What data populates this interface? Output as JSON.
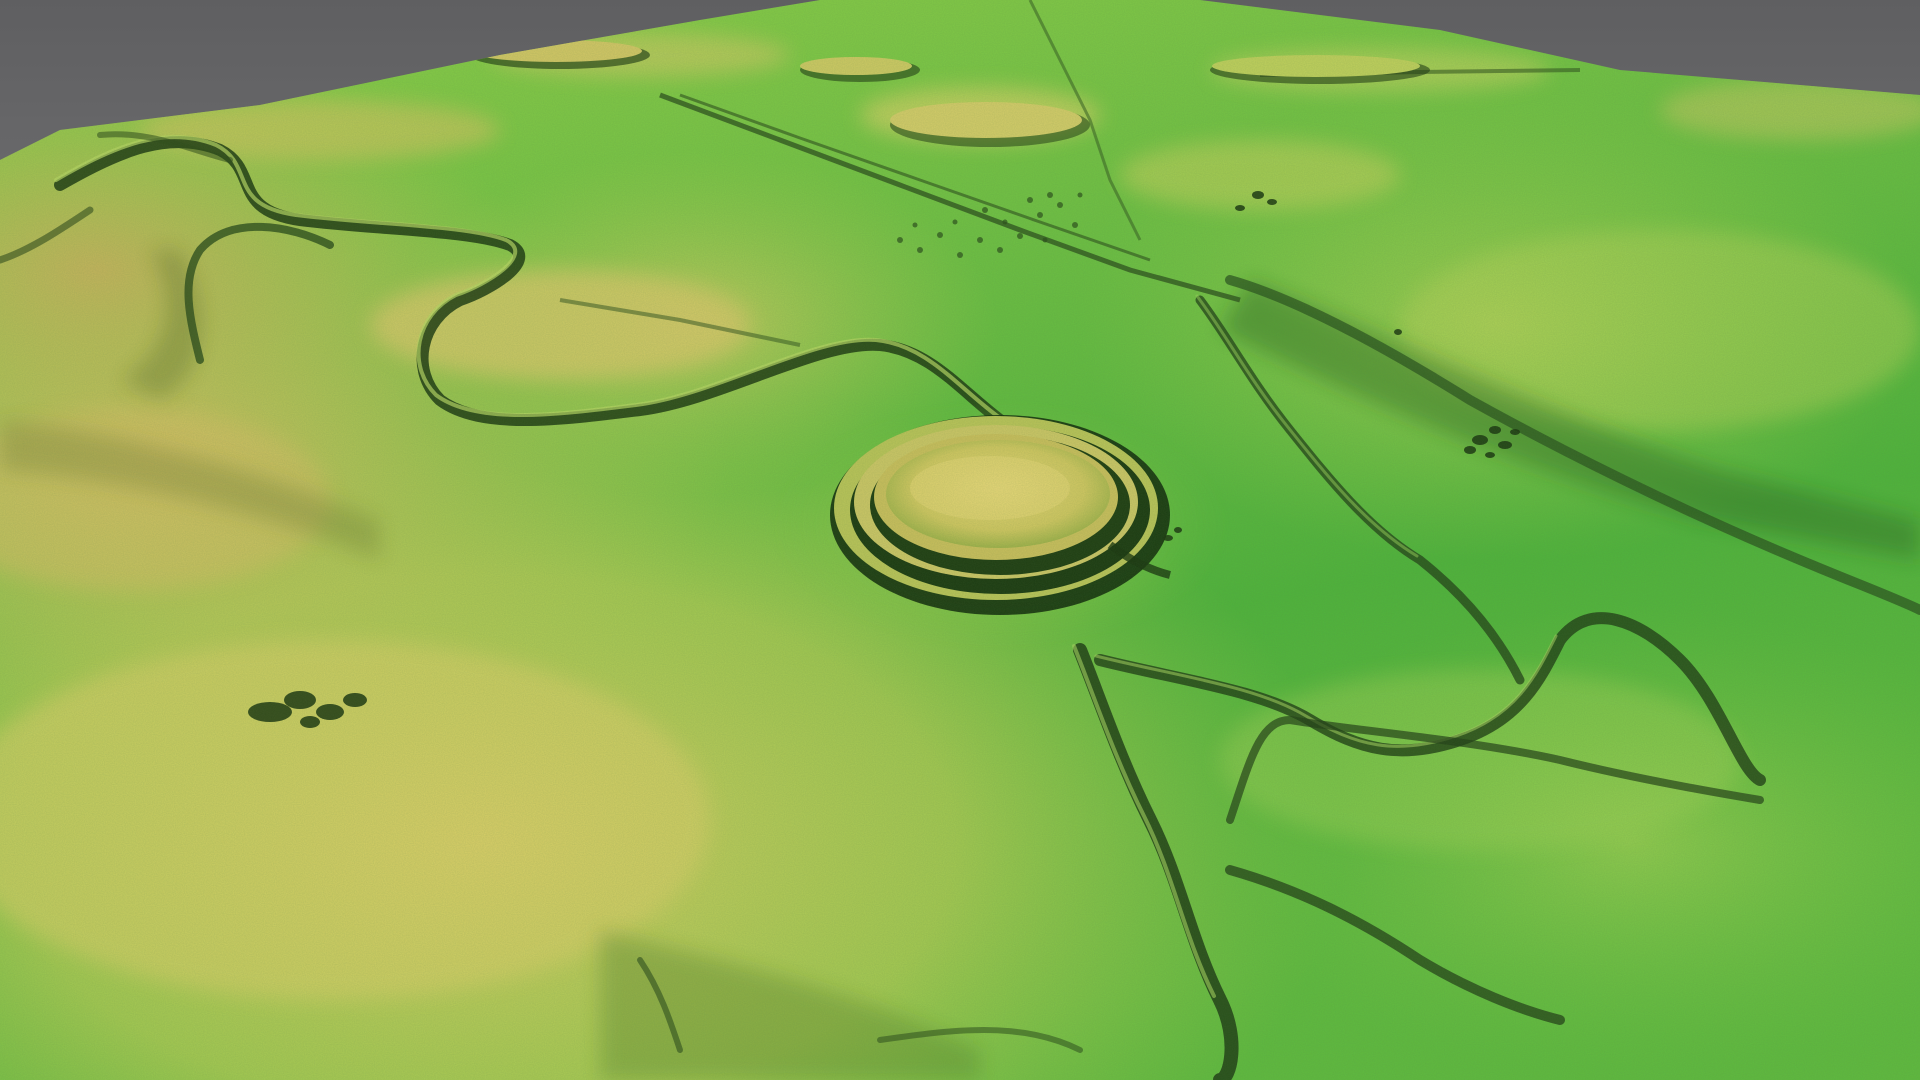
{
  "scene": {
    "kind": "lidar-terrain-hillshade",
    "text_labels": [],
    "palette": {
      "sky_top": "#5f5f61",
      "sky_bottom": "#9a9a9c",
      "low_green": "#3fae3a",
      "mid_green": "#7cc846",
      "yellow_green": "#c2cf5a",
      "high_yellow": "#d8c768",
      "shadow": "#1f3a18"
    },
    "features": [
      "concentric-ringed-hillfort",
      "winding-hollow-ways",
      "linear-trackway",
      "scattered-pits",
      "field-boundary-banks",
      "rolling-ridges"
    ]
  }
}
